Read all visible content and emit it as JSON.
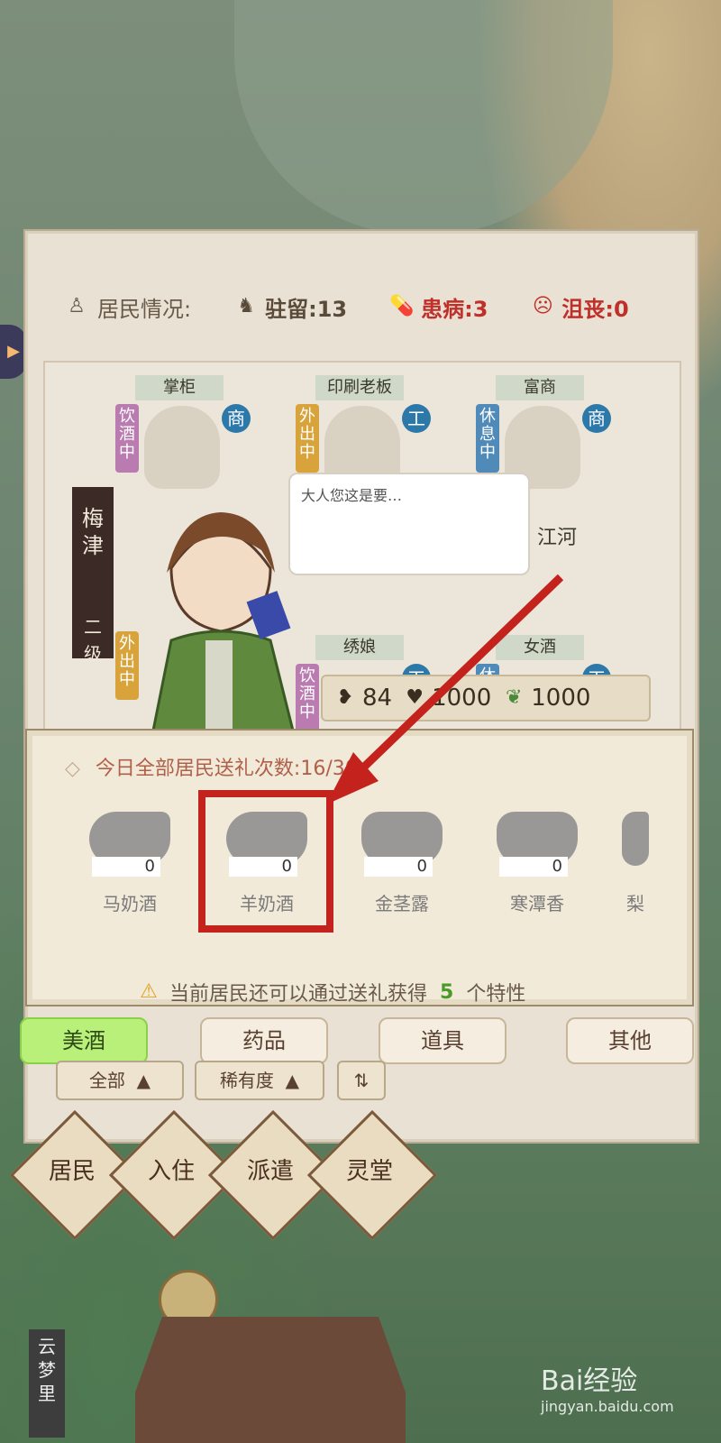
{
  "stats": {
    "label": "居民情况:",
    "stationed": "驻留:13",
    "sick": "患病:3",
    "depressed": "沮丧:0"
  },
  "cards": [
    {
      "title": "掌柜",
      "status": "饮酒中",
      "type": "商",
      "status_color": "#b97bb0"
    },
    {
      "title": "印刷老板",
      "status": "外出中",
      "type": "工",
      "status_color": "#d8a33a"
    },
    {
      "title": "富商",
      "status": "休息中",
      "type": "商",
      "status_color": "#4f8ab8"
    },
    {
      "title": "绣娘",
      "status": "饮酒中",
      "type": "工",
      "status_color": "#b97bb0"
    },
    {
      "title": "女酒",
      "status": "休",
      "type": "工",
      "status_color": "#4f8ab8"
    }
  ],
  "resident": {
    "name": "梅津",
    "level": "二级",
    "status": "外出中",
    "speech": "大人您这是要…",
    "partial_label": "江河"
  },
  "resources": {
    "r1": "84",
    "r2": "1000",
    "r3": "1000"
  },
  "gift": {
    "header": "今日全部居民送礼次数:16/30",
    "items": [
      {
        "name": "马奶酒",
        "qty": "0"
      },
      {
        "name": "羊奶酒",
        "qty": "0"
      },
      {
        "name": "金茎露",
        "qty": "0"
      },
      {
        "name": "寒潭香",
        "qty": "0"
      },
      {
        "name": "梨",
        "qty": ""
      }
    ],
    "tip_prefix": "当前居民还可以通过送礼获得",
    "tip_number": "5",
    "tip_suffix": "个特性"
  },
  "tabs": [
    "美酒",
    "药品",
    "道具",
    "其他"
  ],
  "filters": {
    "all": "全部",
    "rarity": "稀有度"
  },
  "bottom_nav": [
    "居民",
    "入住",
    "派遣",
    "灵堂"
  ],
  "side_label": "云梦里",
  "watermark": {
    "main": "Bai经验",
    "sub": "jingyan.baidu.com"
  },
  "colors": {
    "active_tab": "#b8f07a",
    "highlight": "#c4221c",
    "panel": "#e9e2d4"
  }
}
